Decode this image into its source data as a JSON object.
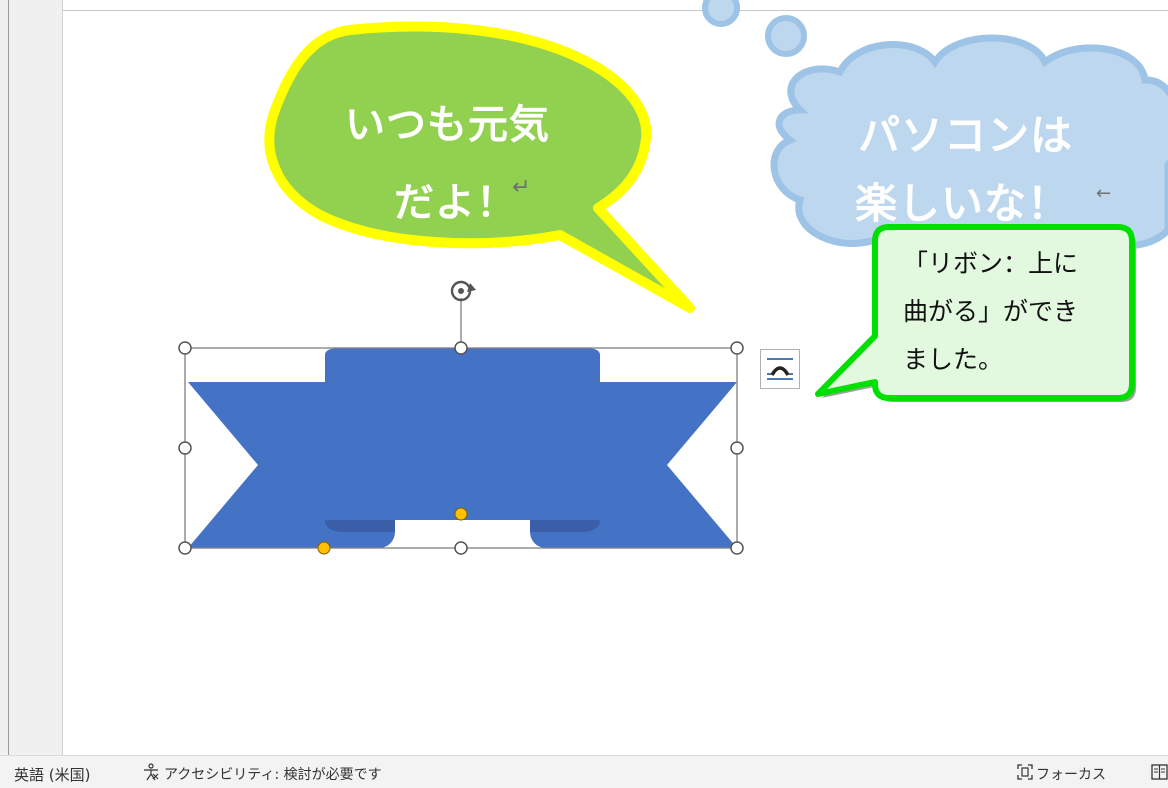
{
  "bubbles": {
    "green": {
      "line1": "いつも元気",
      "line2": "だよ！"
    },
    "cloud": {
      "line1": "パソコンは",
      "line2": "楽しいな！"
    },
    "pilcrow": "↵",
    "cloud_mark": "←"
  },
  "callout": {
    "line1": "「リボン：上に",
    "line2": "曲がる」ができ",
    "line3": "ました。"
  },
  "colors": {
    "ribbon": "#4472c4",
    "ribbon_shade": "#3a5fa8",
    "green_bubble": "#92d050",
    "green_bubble_border": "#ffff00",
    "cloud_fill": "#bdd7ee",
    "cloud_border": "#9dc3e6",
    "callout_fill": "#e2f9e0",
    "callout_border": "#00e000",
    "handle_yellow": "#ffc000"
  },
  "icons": {
    "rotate": "rotate-handle-icon",
    "layout": "layout-options-icon",
    "accessibility": "accessibility-icon",
    "focus": "focus-icon",
    "view": "read-mode-icon"
  },
  "status": {
    "language": "英語 (米国)",
    "accessibility": "アクセシビリティ: 検討が必要です",
    "focus": "フォーカス"
  }
}
